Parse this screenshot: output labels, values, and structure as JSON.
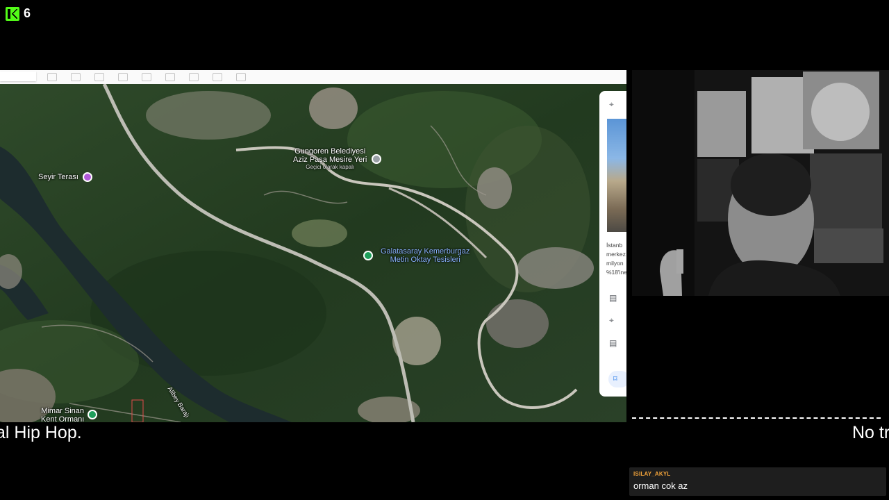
{
  "brand": {
    "logo": "kick-logo-icon",
    "count": "6"
  },
  "map": {
    "labels": {
      "seyir": "Seyir Terası",
      "gungoren_line1": "Gungoren Belediyesi",
      "gungoren_line2": "Aziz Paşa Mesire Yeri",
      "gungoren_sub": "Geçici olarak kapalı",
      "galatasaray_line1": "Galatasaray Kemerburgaz",
      "galatasaray_line2": "Metin Oktay Tesisleri",
      "mimar_line1": "Mimar Sinan",
      "mimar_line2": "Kent Ormanı",
      "alibey": "Alibey Barajı"
    },
    "side_card": {
      "snippet_lines": [
        "İstanb",
        "merkez",
        "milyon",
        "%18'ine"
      ]
    }
  },
  "ticker": {
    "left": "al Hip Hop.",
    "right": "No tr"
  },
  "chat": {
    "username": "ISILAY_AKYL",
    "message": "orman cok az"
  },
  "colors": {
    "accent": "#53fc18",
    "chat_user": "#f2a33a"
  }
}
